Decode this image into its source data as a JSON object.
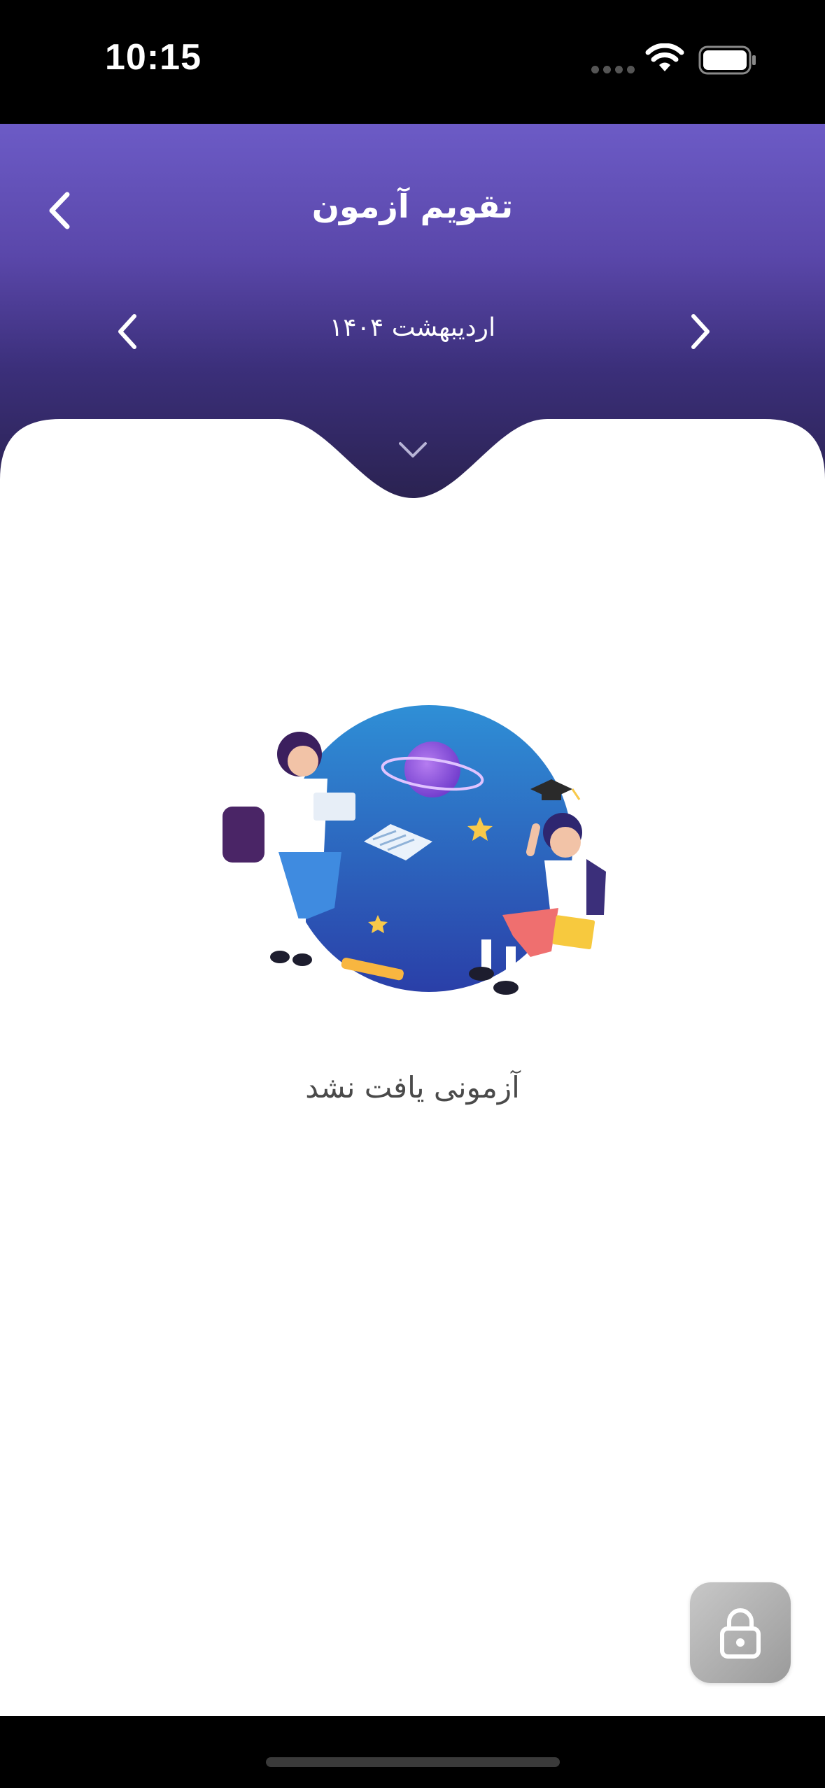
{
  "status_bar": {
    "time": "10:15"
  },
  "header": {
    "title": "تقویم آزمون",
    "month_label": "اردیبهشت ۱۴۰۴",
    "gradient_top": "#6c5bc6",
    "gradient_bottom": "#2a2250"
  },
  "icons": {
    "back": "chevron-left-icon",
    "prev_month": "chevron-left-icon",
    "next_month": "chevron-right-icon",
    "collapse": "chevron-down-icon",
    "lock": "lock-icon"
  },
  "empty_state": {
    "message": "آزمونی یافت نشد"
  },
  "colors": {
    "accent": "#5a47aa",
    "lock_button": "#b0b0b0",
    "text": "#4a4a4a"
  }
}
